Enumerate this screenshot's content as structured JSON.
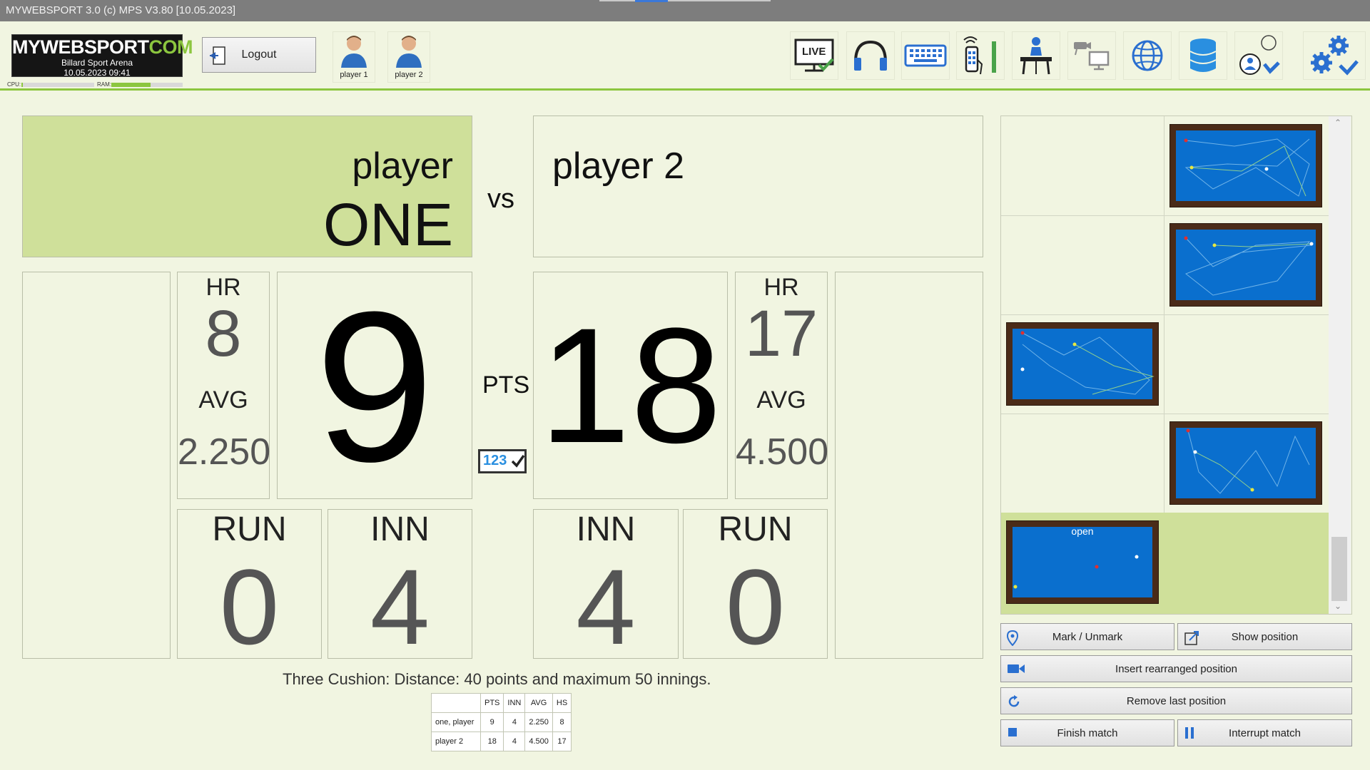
{
  "window": {
    "title": "MYWEBSPORT 3.0  (c) MPS V3.80 [10.05.2023]"
  },
  "header": {
    "logo": {
      "brand_white": "MYWEBSPORT",
      "brand_green": "COM",
      "venue": "Billard Sport Arena",
      "datetime": "10.05.2023  09:41"
    },
    "cpu_label": "CPU:",
    "ram_label": "RAM:",
    "cpu_level": 0.02,
    "ram_level": 0.55,
    "logout_label": "Logout",
    "player_buttons": [
      {
        "label": "player 1"
      },
      {
        "label": "player 2"
      }
    ],
    "toolbar_icons": [
      "live-monitor-icon",
      "headphones-icon",
      "keyboard-icon",
      "remote-control-icon",
      "referee-table-icon",
      "camera-display-icon",
      "globe-icon",
      "database-icon",
      "user-select-icon",
      "settings-select-icon"
    ]
  },
  "match": {
    "player1": {
      "name_line1": "player",
      "name_line2": "ONE",
      "hr_label": "HR",
      "hr": "8",
      "avg_label": "AVG",
      "avg": "2.250",
      "points": "9",
      "run_label": "RUN",
      "run": "0",
      "inn_label": "INN",
      "inn": "4"
    },
    "player2": {
      "name_line1": "player 2",
      "hr_label": "HR",
      "hr": "17",
      "avg_label": "AVG",
      "avg": "4.500",
      "points": "18",
      "run_label": "RUN",
      "run": "0",
      "inn_label": "INN",
      "inn": "4"
    },
    "vs_label": "vs",
    "pts_label": "PTS",
    "counter_badge": "123",
    "discipline": "Three Cushion:",
    "description": "Distance: 40 points and maximum 50 innings."
  },
  "summary": {
    "headers": [
      "",
      "PTS",
      "INN",
      "AVG",
      "HS"
    ],
    "rows": [
      [
        "one, player",
        "9",
        "4",
        "2.250",
        "8"
      ],
      [
        "player 2",
        "18",
        "4",
        "4.500",
        "17"
      ]
    ]
  },
  "positions": {
    "open_label": "open"
  },
  "actions": {
    "mark_unmark": "Mark / Unmark",
    "show_position": "Show position",
    "insert_rearranged": "Insert rearranged position",
    "remove_last": "Remove last position",
    "finish_match": "Finish match",
    "interrupt_match": "Interrupt match"
  },
  "colors": {
    "accent_green": "#8cc63f",
    "player1_bg": "#cfe09a",
    "background": "#f1f5e1",
    "felt": "#0a6fce",
    "rail": "#4a2b18"
  }
}
